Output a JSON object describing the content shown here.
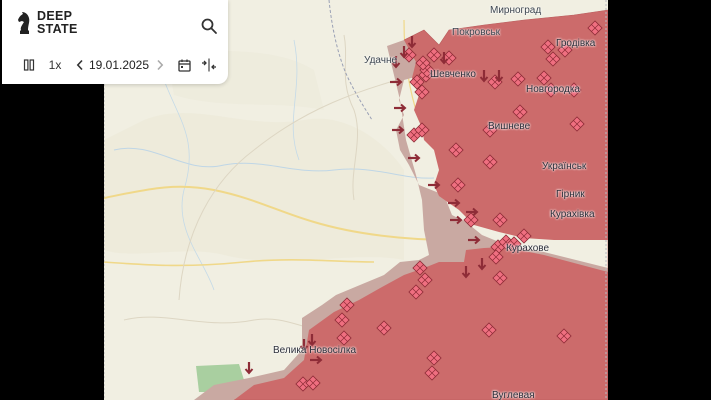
{
  "app": {
    "logo_line1": "DEEP",
    "logo_line2": "STATE"
  },
  "timeline": {
    "speed": "1x",
    "date": "19.01.2025"
  },
  "icons": {
    "logo": "knight-chess-icon",
    "search": "search-icon",
    "pause": "pause-icon",
    "prev": "chevron-left-icon",
    "next": "chevron-right-icon",
    "calendar": "calendar-icon",
    "compare": "compare-arrows-icon"
  },
  "colors": {
    "occupied": "#cc6b6b",
    "contested": "#c9a9a2",
    "marker": "#ef6f80",
    "base_map": "#f1efe2",
    "forest": "#a9cfa0"
  },
  "map": {
    "places": [
      {
        "name": "Мирноград"
      },
      {
        "name": "Покровськ"
      },
      {
        "name": "Удачне"
      },
      {
        "name": "Шевченко"
      },
      {
        "name": "Гродівка"
      },
      {
        "name": "Новгородка"
      },
      {
        "name": "Вишневе"
      },
      {
        "name": "Українськ"
      },
      {
        "name": "Гірник"
      },
      {
        "name": "Курахівка"
      },
      {
        "name": "Курахове"
      },
      {
        "name": "Велика Новосілка"
      },
      {
        "name": "Вуглевая"
      }
    ]
  }
}
